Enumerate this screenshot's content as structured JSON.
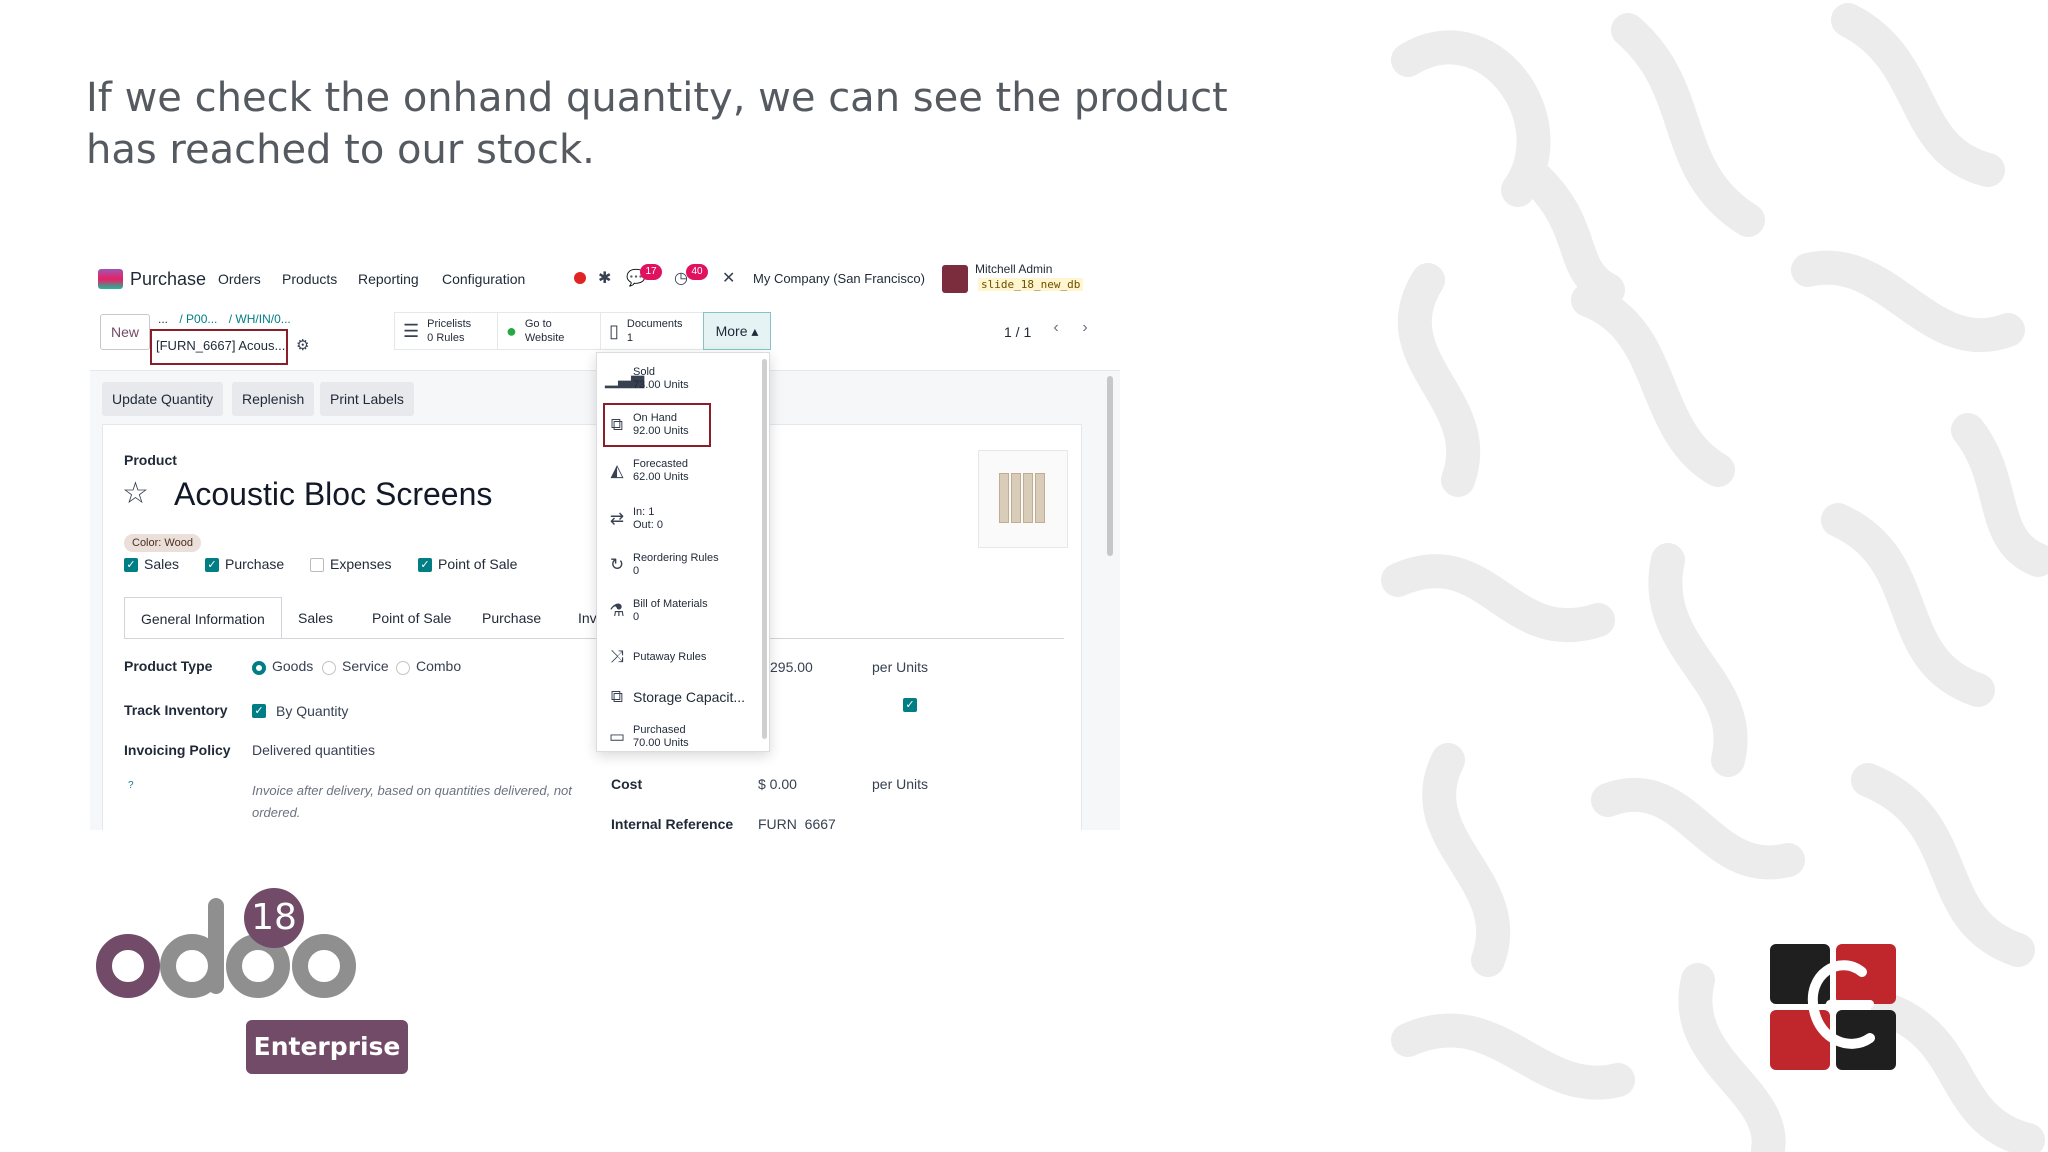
{
  "slide": {
    "heading": "If we check the onhand quantity, we can see the product has reached to our stock."
  },
  "nav": {
    "app_name": "Purchase",
    "menu": [
      "Orders",
      "Products",
      "Reporting",
      "Configuration"
    ],
    "chat_count": "17",
    "activity_count": "40",
    "company": "My Company (San Francisco)",
    "user": "Mitchell Admin",
    "database": "slide_18_new_db"
  },
  "control": {
    "new_label": "New",
    "breadcrumb": [
      "...",
      "/ P00...",
      "/ WH/IN/0..."
    ],
    "record_name": "[FURN_6667] Acous...",
    "pager": "1 / 1",
    "more_label": "More ▴"
  },
  "smart_buttons": [
    {
      "label": "Pricelists",
      "value": "0 Rules",
      "icon": "list-icon"
    },
    {
      "label": "Go to",
      "value": "Website",
      "icon": "globe-icon"
    },
    {
      "label": "Documents",
      "value": "1",
      "icon": "document-icon"
    }
  ],
  "actions": [
    "Update Quantity",
    "Replenish",
    "Print Labels"
  ],
  "product": {
    "label": "Product",
    "name": "Acoustic Bloc Screens",
    "tag": "Color: Wood",
    "flags": [
      {
        "label": "Sales",
        "checked": true
      },
      {
        "label": "Purchase",
        "checked": true
      },
      {
        "label": "Expenses",
        "checked": false
      },
      {
        "label": "Point of Sale",
        "checked": true
      }
    ]
  },
  "tabs": [
    "General Information",
    "Sales",
    "Point of Sale",
    "Purchase",
    "Invent"
  ],
  "fields": {
    "product_type_label": "Product Type",
    "type_options": [
      "Goods",
      "Service",
      "Combo"
    ],
    "track_inventory_label": "Track Inventory",
    "track_inventory_value": "By Quantity",
    "invoicing_policy_label": "Invoicing Policy",
    "invoicing_policy_value": "Delivered quantities",
    "invoicing_hint": "Invoice after delivery, based on quantities delivered, not ordered.",
    "sales_price_value": "295.00",
    "per_units_1": "per Units",
    "cost_label": "Cost",
    "cost_value": "$ 0.00",
    "per_units_2": "per Units",
    "internal_ref_label": "Internal Reference",
    "internal_ref_value": "FURN_6667"
  },
  "dropdown": [
    {
      "label": "Sold",
      "value": "73.00 Units",
      "icon": "bar-chart-icon"
    },
    {
      "label": "On Hand",
      "value": "92.00 Units",
      "icon": "cubes-icon"
    },
    {
      "label": "Forecasted",
      "value": "62.00 Units",
      "icon": "area-chart-icon"
    },
    {
      "label": "In: 1",
      "value": "Out: 0",
      "icon": "exchange-icon"
    },
    {
      "label": "Reordering Rules",
      "value": "0",
      "icon": "refresh-icon"
    },
    {
      "label": "Bill of Materials",
      "value": "0",
      "icon": "flask-icon"
    },
    {
      "label": "Putaway Rules",
      "value": "",
      "icon": "random-icon"
    },
    {
      "label": "Storage Capacit...",
      "value": "",
      "icon": "cubes-icon"
    },
    {
      "label": "Purchased",
      "value": "70.00 Units",
      "icon": "credit-card-icon"
    }
  ],
  "branding": {
    "version": "18",
    "edition": "Enterprise"
  },
  "colors": {
    "brand": "#714b67",
    "accent": "#017e84",
    "highlight": "#8a1f2a"
  }
}
